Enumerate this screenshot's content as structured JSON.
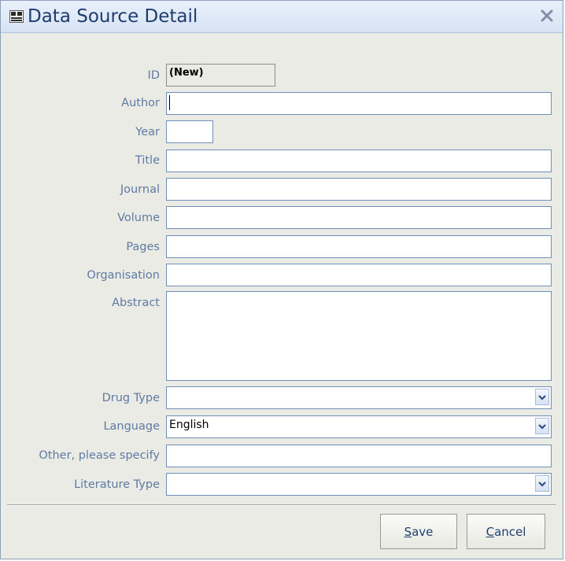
{
  "window": {
    "title": "Data Source Detail",
    "app_icon": "database-form-icon",
    "close_icon": "close-icon"
  },
  "form": {
    "id": {
      "label": "ID",
      "value": "(New)"
    },
    "author": {
      "label": "Author",
      "value": ""
    },
    "year": {
      "label": "Year",
      "value": ""
    },
    "title": {
      "label": "Title",
      "value": ""
    },
    "journal": {
      "label": "Journal",
      "value": ""
    },
    "volume": {
      "label": "Volume",
      "value": ""
    },
    "pages": {
      "label": "Pages",
      "value": ""
    },
    "organisation": {
      "label": "Organisation",
      "value": ""
    },
    "abstract": {
      "label": "Abstract",
      "value": ""
    },
    "drug_type": {
      "label": "Drug Type",
      "value": ""
    },
    "language": {
      "label": "Language",
      "value": "English"
    },
    "other": {
      "label": "Other, please specify",
      "value": ""
    },
    "literature_type": {
      "label": "Literature Type",
      "value": ""
    }
  },
  "buttons": {
    "save": {
      "mnemonic": "S",
      "rest": "ave"
    },
    "cancel": {
      "mnemonic": "C",
      "rest": "ancel"
    }
  },
  "colors": {
    "label_text": "#5f7aa2",
    "title_text": "#1f3d6b",
    "field_border": "#6f8fb9",
    "window_bg": "#ebebe6"
  }
}
